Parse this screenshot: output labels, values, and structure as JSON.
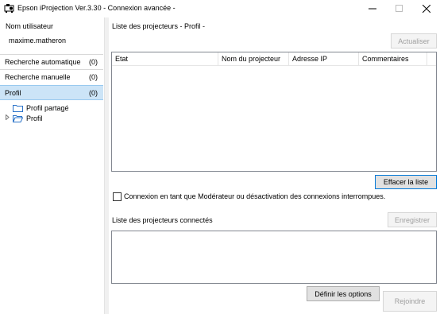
{
  "window": {
    "title": "Epson iProjection Ver.3.30 - Connexion avancée -"
  },
  "left_panel": {
    "user_label": "Nom utilisateur",
    "user_value": "maxime.matheron",
    "nav": [
      {
        "label": "Recherche automatique",
        "count": "(0)"
      },
      {
        "label": "Recherche manuelle",
        "count": "(0)"
      },
      {
        "label": "Profil",
        "count": "(0)"
      }
    ],
    "tree": [
      {
        "label": "Profil partagé"
      },
      {
        "label": "Profil"
      }
    ]
  },
  "right_panel": {
    "list_title": "Liste des projecteurs - Profil -",
    "refresh_button": "Actualiser",
    "columns": [
      "Etat",
      "Nom du projecteur",
      "Adresse IP",
      "Commentaires"
    ],
    "clear_button": "Effacer la liste",
    "checkbox_label": "Connexion en tant que Modérateur ou désactivation des connexions interrompues.",
    "checkbox_checked": false,
    "connected_title": "Liste des projecteurs connectés",
    "register_button": "Enregistrer",
    "options_button": "Définir les options",
    "join_button": "Rejoindre"
  },
  "colors": {
    "selection": "#cce4f7",
    "accent": "#0078d7"
  }
}
